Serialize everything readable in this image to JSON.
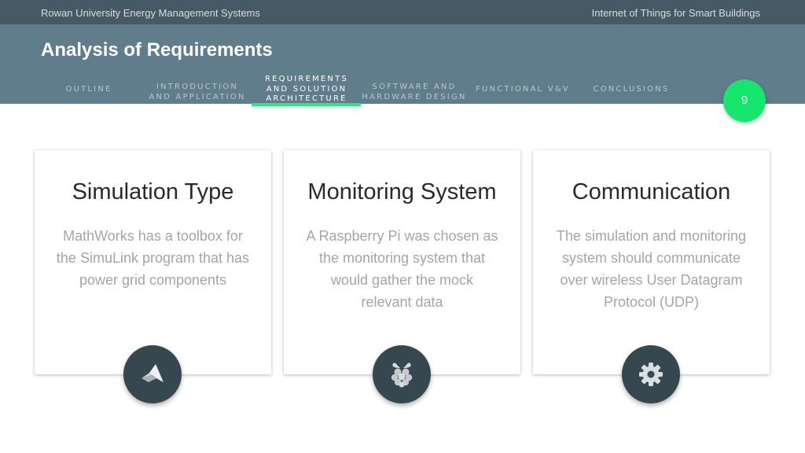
{
  "top_bar": {
    "left_text": "Rowan University Energy Management Systems",
    "right_text": "Internet of Things for Smart Buildings"
  },
  "slide_title": "Analysis of Requirements",
  "nav": [
    {
      "line1": "OUTLINE",
      "line2": "",
      "line3": "",
      "active": false
    },
    {
      "line1": "INTRODUCTION",
      "line2": "AND APPLICATION",
      "line3": "",
      "active": false
    },
    {
      "line1": "REQUIREMENTS",
      "line2": "AND SOLUTION",
      "line3": "ARCHITECTURE",
      "active": true
    },
    {
      "line1": "SOFTWARE AND",
      "line2": "HARDWARE DESIGN",
      "line3": "",
      "active": false
    },
    {
      "line1": "FUNCTIONAL V&V",
      "line2": "",
      "line3": "",
      "active": false
    },
    {
      "line1": "CONCLUSIONS",
      "line2": "",
      "line3": "",
      "active": false
    }
  ],
  "page_number": "9",
  "cards": [
    {
      "title": "Simulation Type",
      "body": "MathWorks has a toolbox for the SimuLink program that has power grid components",
      "icon": "matlab-icon"
    },
    {
      "title": "Monitoring System",
      "body": "A Raspberry Pi was chosen as the monitoring system that would gather the mock relevant data",
      "icon": "raspberry-pi-icon"
    },
    {
      "title": "Communication",
      "body": "The simulation and monitoring system should communicate over wireless User Datagram Protocol (UDP)",
      "icon": "gear-icon"
    }
  ],
  "colors": {
    "top_bar": "#455a64",
    "header": "#607d8b",
    "accent": "#14e66e",
    "icon_circle": "#37474f"
  }
}
